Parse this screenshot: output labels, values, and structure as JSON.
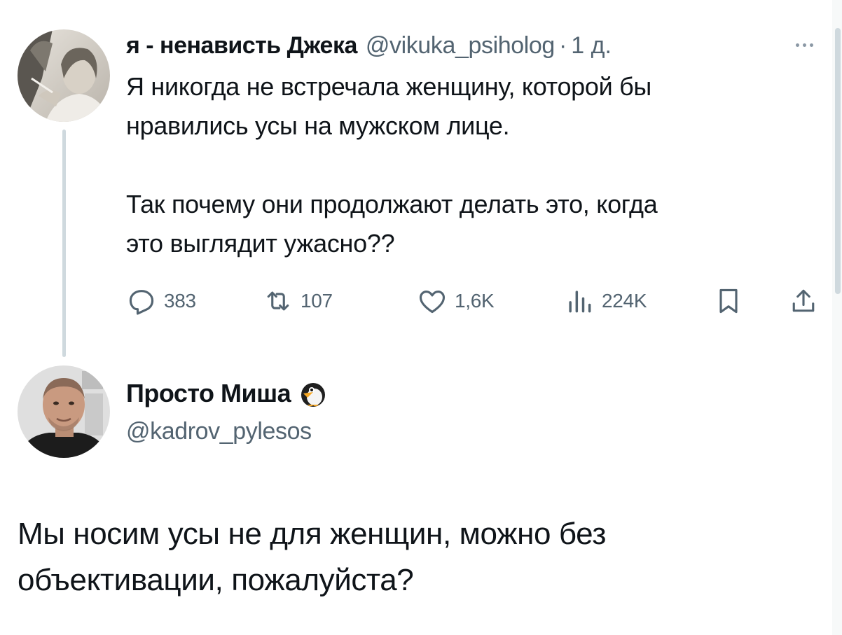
{
  "tweet1": {
    "author_name": "я - ненависть Джека",
    "handle": "@vikuka_psiholog",
    "separator": "·",
    "time": "1 д.",
    "text_lines": [
      "Я никогда не встречала женщину, которой бы",
      "нравились усы на мужском лице.",
      "Так почему они продолжают делать это, когда",
      "это выглядит ужасно??"
    ],
    "actions": {
      "reply": {
        "icon": "reply-icon",
        "count": "383"
      },
      "retweet": {
        "icon": "retweet-icon",
        "count": "107"
      },
      "like": {
        "icon": "heart-icon",
        "count": "1,6K"
      },
      "views": {
        "icon": "views-icon",
        "count": "224K"
      },
      "bookmark": {
        "icon": "bookmark-icon"
      },
      "share": {
        "icon": "share-icon"
      }
    }
  },
  "tweet2": {
    "author_name": "Просто Миша",
    "name_emoji": "penguin-icon",
    "handle": "@kadrov_pylesos",
    "text_lines": [
      "Мы носим усы не для женщин, можно без",
      "объективации, пожалуйста?"
    ]
  },
  "colors": {
    "text_primary": "#0f1419",
    "text_secondary": "#536471",
    "thread_line": "#cfd9de"
  }
}
